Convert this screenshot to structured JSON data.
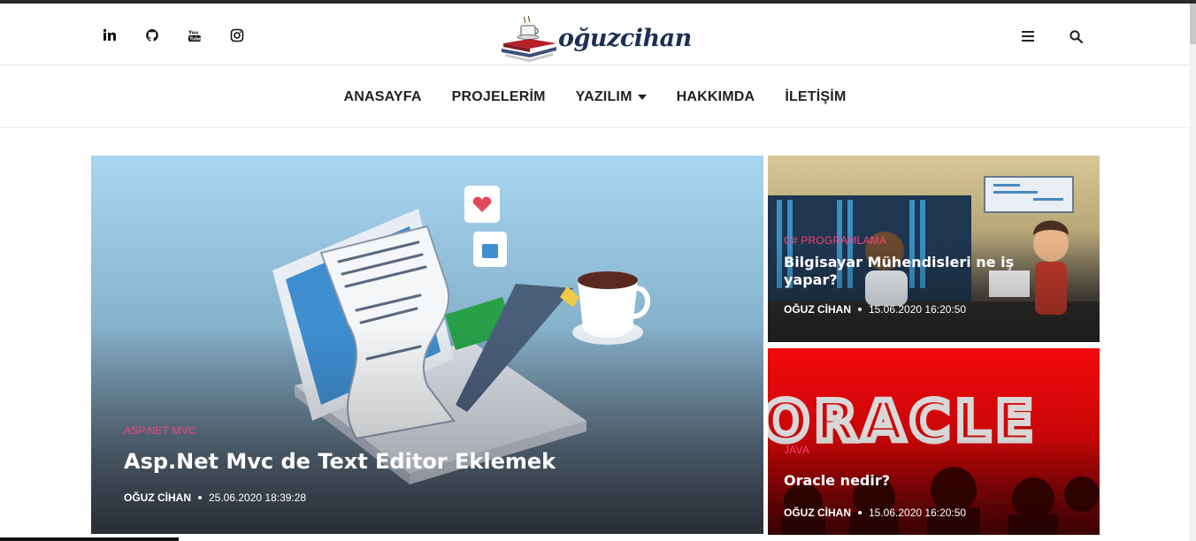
{
  "social": [
    {
      "name": "linkedin-icon"
    },
    {
      "name": "github-icon"
    },
    {
      "name": "youtube-icon"
    },
    {
      "name": "instagram-icon"
    }
  ],
  "logo": {
    "text": "oğuzcihan"
  },
  "nav": {
    "items": [
      "ANASAYFA",
      "PROJELERİM",
      "YAZILIM",
      "HAKKIMDA",
      "İLETİŞİM"
    ]
  },
  "posts": [
    {
      "category": "ASP.NET MVC",
      "title": "Asp.Net Mvc de Text Editor Eklemek",
      "author": "OĞUZ CİHAN",
      "date": "25.06.2020 18:39:28"
    },
    {
      "category": "C# PROGRAMLAMA",
      "title": "Bilgisayar Mühendisleri ne iş yapar?",
      "author": "OĞUZ CİHAN",
      "date": "15.06.2020 16:20:50"
    },
    {
      "category": "JAVA",
      "title": "Oracle nedir?",
      "author": "OĞUZ CİHAN",
      "date": "15.06.2020 16:20:50",
      "banner": "ORACLE"
    }
  ],
  "colors": {
    "accent": "#ff3f78",
    "brand": "#1d2f55"
  }
}
